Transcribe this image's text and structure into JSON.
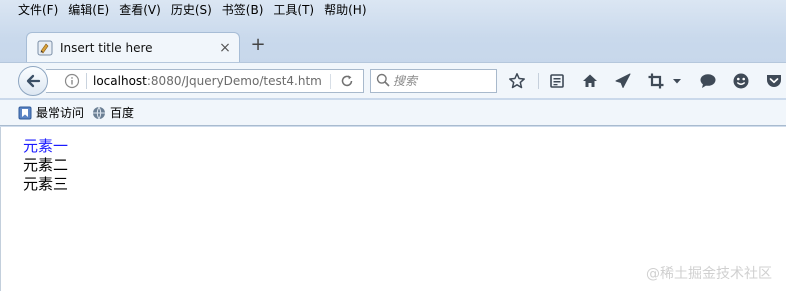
{
  "menubar": {
    "items": [
      "文件(F)",
      "编辑(E)",
      "查看(V)",
      "历史(S)",
      "书签(B)",
      "工具(T)",
      "帮助(H)"
    ]
  },
  "tab": {
    "title": "Insert title here",
    "close_label": "×"
  },
  "new_tab_label": "+",
  "urlbar": {
    "host": "localhost",
    "rest": ":8080/JqueryDemo/test4.htm"
  },
  "search": {
    "placeholder": "搜索"
  },
  "toolbar_icons": [
    "star-icon",
    "reading-list-icon",
    "home-icon",
    "send-icon",
    "crop-icon",
    "dropdown-icon",
    "chat-icon",
    "smiley-icon",
    "pocket-icon"
  ],
  "bookmarks": [
    {
      "label": "最常访问",
      "icon": "bookmark-icon"
    },
    {
      "label": "百度",
      "icon": "globe-icon"
    }
  ],
  "content": {
    "lines": [
      {
        "text": "元素一",
        "color": "#1a1aff"
      },
      {
        "text": "元素二",
        "color": "#000000"
      },
      {
        "text": "元素三",
        "color": "#000000"
      }
    ]
  },
  "watermark": "@稀土掘金技术社区",
  "colors": {
    "chrome_bg": "#c9d9ec",
    "accent_link": "#1a1aff"
  }
}
